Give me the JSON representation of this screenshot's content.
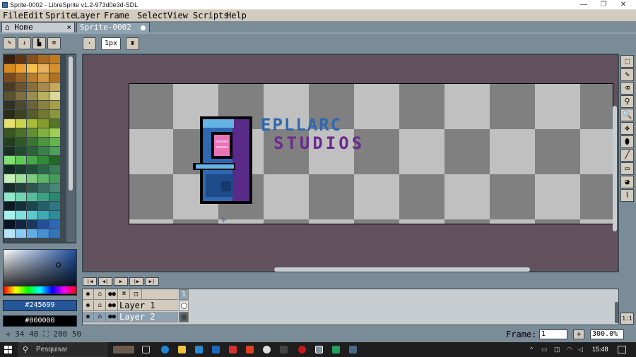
{
  "window": {
    "title": "Sprite-0002 - LibreSprite v1.2-973d0e3d-SDL"
  },
  "menu": [
    "File",
    "Edit",
    "Sprite",
    "Layer",
    "Frame",
    "Select",
    "View",
    "Scripts",
    "Help"
  ],
  "tabs": {
    "home": "Home",
    "home_close": "×",
    "sprite": "Sprite-0002"
  },
  "context": {
    "brush_size": "1px"
  },
  "palette": {
    "colors": [
      "#3a1e10",
      "#5e3412",
      "#86501a",
      "#a8691e",
      "#c07a22",
      "#d88a1a",
      "#f0a030",
      "#f6c24a",
      "#e8b060",
      "#d4902a",
      "#7a4a1c",
      "#9a6224",
      "#b87c30",
      "#d09a44",
      "#b07020",
      "#4a3a22",
      "#6a5430",
      "#8a6e3c",
      "#aa8a4a",
      "#c8a658",
      "#5a5230",
      "#7a7040",
      "#9a8e50",
      "#bab060",
      "#dad898",
      "#323022",
      "#4c4830",
      "#6a6438",
      "#8a8240",
      "#a8a048",
      "#2a2c18",
      "#3e4222",
      "#565c2a",
      "#707832",
      "#8c963c",
      "#e6e070",
      "#ccd44c",
      "#a8bc38",
      "#849c30",
      "#587428",
      "#3c5620",
      "#4c7026",
      "#649032",
      "#80b03e",
      "#a0d050",
      "#20401c",
      "#2c5826",
      "#3a7432",
      "#4c943e",
      "#64b44c",
      "#183020",
      "#224a2c",
      "#2c643a",
      "#3a8048",
      "#4ca058",
      "#80e070",
      "#60c858",
      "#48a848",
      "#348838",
      "#246828",
      "#102a20",
      "#183c2c",
      "#205038",
      "#2a6646",
      "#387e56",
      "#c6f0b8",
      "#a0e098",
      "#7ccc80",
      "#5cb468",
      "#449c58",
      "#1a2a2a",
      "#24403c",
      "#2e564e",
      "#3a6e62",
      "#488678",
      "#92e8c8",
      "#70d4b0",
      "#54bc9a",
      "#3ca284",
      "#2a886e",
      "#0c1c22",
      "#12303a",
      "#1a4650",
      "#245e68",
      "#2e7680",
      "#a8f0ec",
      "#80e0e0",
      "#5cc8cc",
      "#40aab4",
      "#2c8c9c",
      "#0a1424",
      "#122440",
      "#1a365c",
      "#245099",
      "#2e68b4",
      "#b8e4f8",
      "#8ccaf0",
      "#64ace4",
      "#4890d4",
      "#3474bc"
    ]
  },
  "color": {
    "foreground": "#245699",
    "background": "#000000"
  },
  "layers": [
    {
      "name": "Layer 1"
    },
    {
      "name": "Layer 2"
    }
  ],
  "timeline": {
    "frame_number": "1"
  },
  "status": {
    "coords": "34 48",
    "size": "200 50"
  },
  "frame": {
    "label": "Frame:",
    "value": "1",
    "add": "+",
    "zoom": "300.0%"
  },
  "taskbar": {
    "search_placeholder": "Pesquisar",
    "time": "15:48"
  },
  "sprite_text": {
    "line1": "EPLLARC",
    "line2": "STUDIOS"
  },
  "colors": {
    "menubar": "#d3cbbe",
    "editor_bg": "#61525e",
    "checker_light": "#c0c0c0",
    "checker_dark": "#808080",
    "ui_bg": "#7b8c99"
  }
}
